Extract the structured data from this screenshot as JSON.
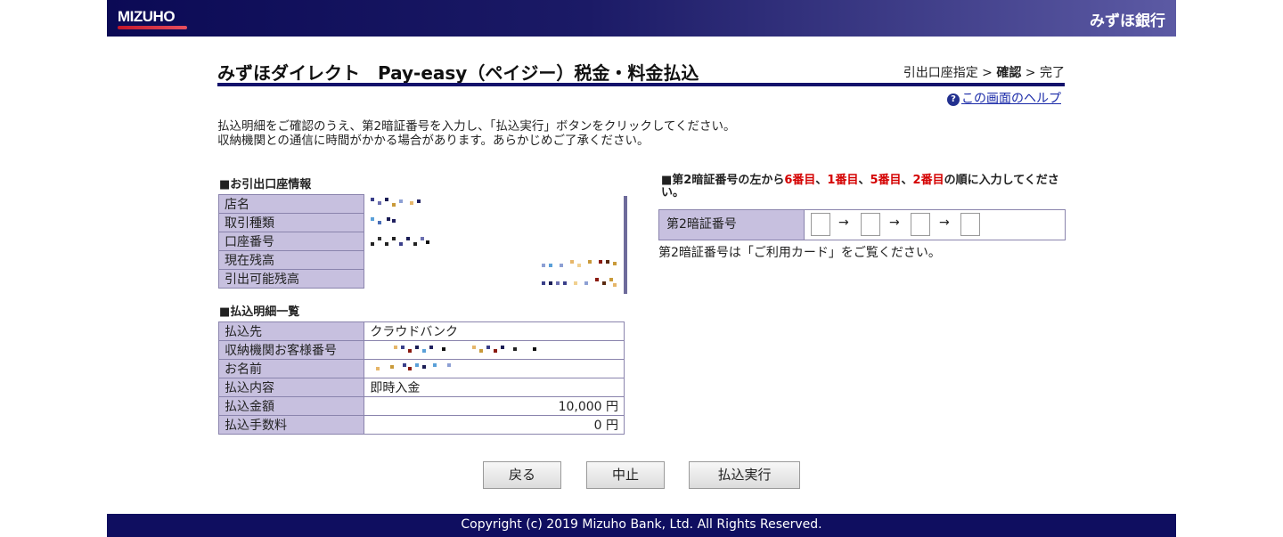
{
  "header": {
    "logo": "MIZUHO",
    "bank_name": "みずほ銀行"
  },
  "page": {
    "title": "みずほダイレクト　Pay-easy（ペイジー）税金・料金払込",
    "steps": {
      "step1": "引出口座指定",
      "sep1": " > ",
      "step2": "確認",
      "sep2": " > ",
      "step3": "完了"
    },
    "help_link": "この画面のヘルプ",
    "intro_line1": "払込明細をご確認のうえ、第2暗証番号を入力し、「払込実行」ボタンをクリックしてください。",
    "intro_line2": "収納機関との通信に時間がかかる場合があります。あらかじめご了承ください。"
  },
  "account_section": {
    "title": "■お引出口座情報",
    "rows": [
      "店名",
      "取引種類",
      "口座番号",
      "現在残高",
      "引出可能残高"
    ]
  },
  "payment_section": {
    "title": "■払込明細一覧",
    "rows": [
      {
        "label": "払込先",
        "value": "クラウドバンク"
      },
      {
        "label": "収納機関お客様番号",
        "value": ""
      },
      {
        "label": "お名前",
        "value": ""
      },
      {
        "label": "払込内容",
        "value": "即時入金"
      },
      {
        "label": "払込金額",
        "value": "10,000 円"
      },
      {
        "label": "払込手数料",
        "value": "0 円"
      }
    ]
  },
  "pin_section": {
    "label_prefix": "■第2暗証番号の左から",
    "d1": "6番目",
    "d2": "1番目",
    "d3": "5番目",
    "d4": "2番目",
    "comma": "、",
    "label_suffix": "の順に入力してください。",
    "field_label": "第2暗証番号",
    "arrow": "→",
    "note": "第2暗証番号は「ご利用カード」をご覧ください。"
  },
  "buttons": {
    "back": "戻る",
    "cancel": "中止",
    "execute": "払込実行"
  },
  "footer": {
    "copyright": "Copyright (c) 2019 Mizuho Bank, Ltd. All Rights Reserved."
  },
  "colors": {
    "header_dark": "#0b0a55",
    "label_bg": "#c7c0df",
    "accent_red": "#d40000",
    "link": "#1a2aa8"
  }
}
